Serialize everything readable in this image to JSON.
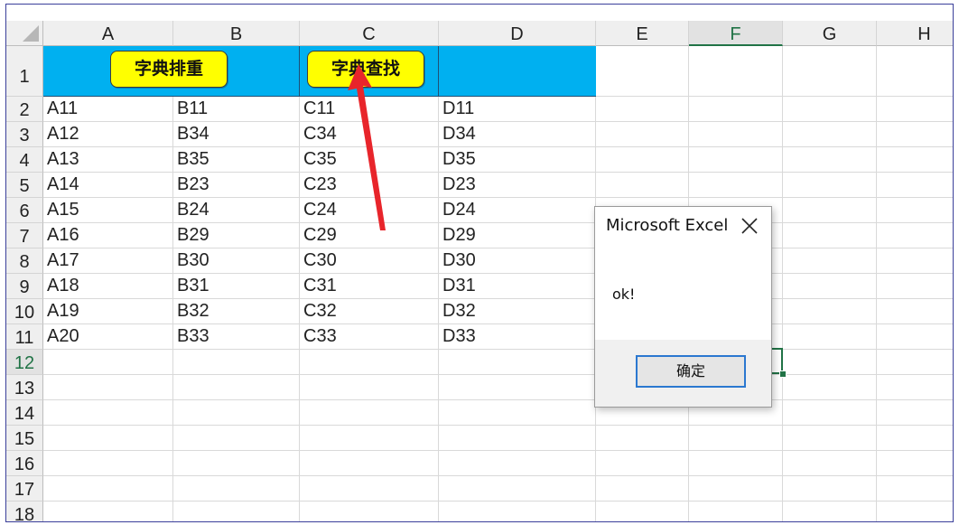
{
  "sheet": {
    "columns": [
      "A",
      "B",
      "C",
      "D",
      "E",
      "F",
      "G",
      "H"
    ],
    "active_column": "F",
    "rows": [
      "1",
      "2",
      "3",
      "4",
      "5",
      "6",
      "7",
      "8",
      "9",
      "10",
      "11",
      "12",
      "13",
      "14",
      "15",
      "16",
      "17",
      "18"
    ],
    "active_row": "12",
    "table": [
      [
        "A11",
        "B11",
        "C11",
        "D11"
      ],
      [
        "A12",
        "B34",
        "C34",
        "D34"
      ],
      [
        "A13",
        "B35",
        "C35",
        "D35"
      ],
      [
        "A14",
        "B23",
        "C23",
        "D23"
      ],
      [
        "A15",
        "B24",
        "C24",
        "D24"
      ],
      [
        "A16",
        "B29",
        "C29",
        "D29"
      ],
      [
        "A17",
        "B30",
        "C30",
        "D30"
      ],
      [
        "A18",
        "B31",
        "C31",
        "D31"
      ],
      [
        "A19",
        "B32",
        "C32",
        "D32"
      ],
      [
        "A20",
        "B33",
        "C33",
        "D33"
      ]
    ],
    "header_fill_color": "#00b0f0",
    "grid_color": "#d9d9d9",
    "accent_color": "#217346"
  },
  "buttons": {
    "dedupe_label": "字典排重",
    "lookup_label": "字典查找",
    "fill_color": "#ffff00"
  },
  "annotation": {
    "arrow_color": "#e8252b",
    "points_to": "lookup_button"
  },
  "dialog": {
    "title": "Microsoft Excel",
    "close_icon": "close-icon",
    "message": "ok!",
    "ok_label": "确定"
  }
}
